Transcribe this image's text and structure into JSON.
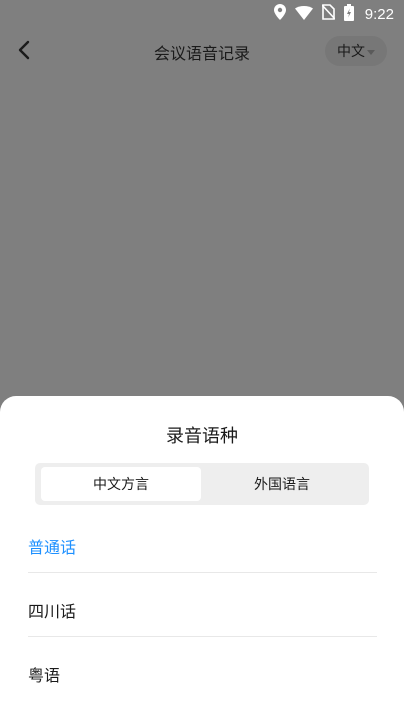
{
  "status_bar": {
    "time": "9:22",
    "icons": [
      "location-icon",
      "wifi-icon",
      "no-sim-icon",
      "battery-icon"
    ]
  },
  "nav": {
    "back_icon": "chevron-left-icon",
    "title": "会议语音记录",
    "language_label": "中文"
  },
  "sheet": {
    "title": "录音语种",
    "tabs": [
      {
        "label": "中文方言",
        "active": true
      },
      {
        "label": "外国语言",
        "active": false
      }
    ],
    "options": [
      {
        "label": "普通话",
        "selected": true
      },
      {
        "label": "四川话",
        "selected": false
      },
      {
        "label": "粤语",
        "selected": false
      }
    ]
  },
  "colors": {
    "accent": "#1e90ff",
    "overlay": "#7f7f7f",
    "sheet_bg": "#ffffff",
    "segment_bg": "#eeeeee"
  }
}
